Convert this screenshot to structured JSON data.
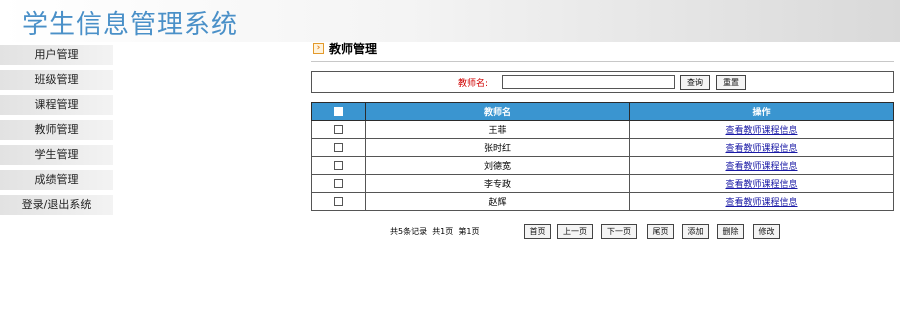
{
  "app": {
    "title": "学生信息管理系统"
  },
  "sidebar": {
    "items": [
      {
        "label": "用户管理"
      },
      {
        "label": "班级管理"
      },
      {
        "label": "课程管理"
      },
      {
        "label": "教师管理"
      },
      {
        "label": "学生管理"
      },
      {
        "label": "成绩管理"
      },
      {
        "label": "登录/退出系统"
      }
    ]
  },
  "section": {
    "title": "教师管理"
  },
  "search": {
    "label": "教师名:",
    "value": "",
    "query_label": "查询",
    "reset_label": "重置"
  },
  "table": {
    "headers": {
      "name": "教师名",
      "action": "操作"
    },
    "rows": [
      {
        "name": "王菲",
        "action": "查看教师课程信息"
      },
      {
        "name": "张时红",
        "action": "查看教师课程信息"
      },
      {
        "name": "刘德宽",
        "action": "查看教师课程信息"
      },
      {
        "name": "李专政",
        "action": "查看教师课程信息"
      },
      {
        "name": "赵辉",
        "action": "查看教师课程信息"
      }
    ]
  },
  "pager": {
    "total_records": "共5条记录",
    "total_pages": "共1页",
    "current_page": "第1页",
    "first": "首页",
    "prev": "上一页",
    "next": "下一页",
    "last": "尾页",
    "add": "添加",
    "delete": "删除",
    "edit": "修改"
  },
  "colors": {
    "title_blue": "#4a90c8",
    "table_header": "#3a95d0",
    "search_label_red": "#d00000",
    "link_blue": "#1a1aa6"
  }
}
